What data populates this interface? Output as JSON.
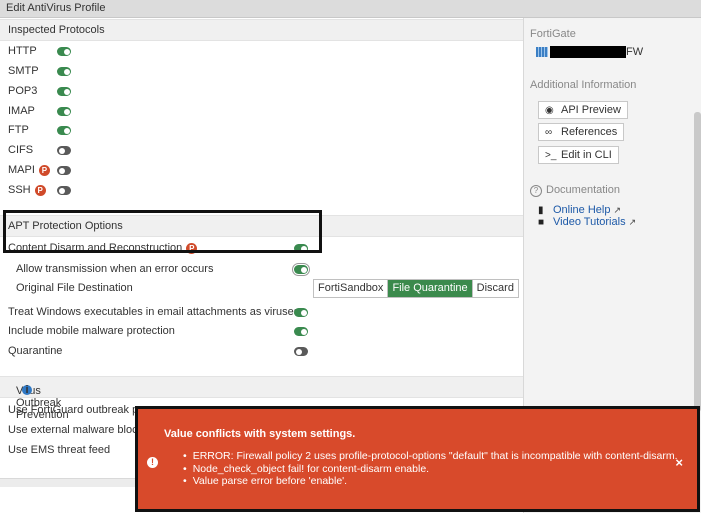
{
  "window": {
    "title": "Edit AntiVirus Profile"
  },
  "inspected": {
    "heading": "Inspected Protocols",
    "protocols": [
      {
        "label": "HTTP",
        "on": true,
        "p": false
      },
      {
        "label": "SMTP",
        "on": true,
        "p": false
      },
      {
        "label": "POP3",
        "on": true,
        "p": false
      },
      {
        "label": "IMAP",
        "on": true,
        "p": false
      },
      {
        "label": "FTP",
        "on": true,
        "p": false
      },
      {
        "label": "CIFS",
        "on": false,
        "p": false
      },
      {
        "label": "MAPI",
        "on": false,
        "p": true
      },
      {
        "label": "SSH",
        "on": false,
        "p": true
      }
    ],
    "badge_letter": "P"
  },
  "apt": {
    "heading": "APT Protection Options",
    "cdr_label": "Content Disarm and Reconstruction",
    "allow_error_label": "Allow transmission when an error occurs",
    "orig_dest_label": "Original File Destination",
    "dest_options": [
      "FortiSandbox",
      "File Quarantine",
      "Discard"
    ],
    "dest_selected": "File Quarantine",
    "treat_windows_label": "Treat Windows executables in email attachments as viruses",
    "mobile_label": "Include mobile malware protection",
    "quarantine_label": "Quarantine"
  },
  "outbreak": {
    "heading": "Virus Outbreak Prevention",
    "info_icon": "i",
    "fortiguard_label": "Use FortiGuard outbreak pr",
    "external_label": "Use external malware block",
    "ems_label": "Use EMS threat feed"
  },
  "sidebar": {
    "fortigate_label": "FortiGate",
    "device_suffix": "FW",
    "additional_label": "Additional Information",
    "api_preview": "API Preview",
    "references": "References",
    "edit_cli": "Edit in CLI",
    "documentation": "Documentation",
    "online_help": "Online Help",
    "video_tutorials": "Video Tutorials"
  },
  "error": {
    "title": "Value conflicts with system settings.",
    "items": [
      "ERROR: Firewall policy 2 uses profile-protocol-options \"default\" that is incompatible with content-disarm.",
      "Node_check_object fail! for content-disarm enable.",
      "Value parse error before 'enable'."
    ],
    "icon": "!",
    "close": "×"
  },
  "colors": {
    "toggle_on": "#3a8a4f",
    "toggle_off": "#5a5a5a",
    "error_bg": "#d84a2b",
    "selected_seg": "#3b8a4c",
    "link": "#1e5aa8"
  }
}
